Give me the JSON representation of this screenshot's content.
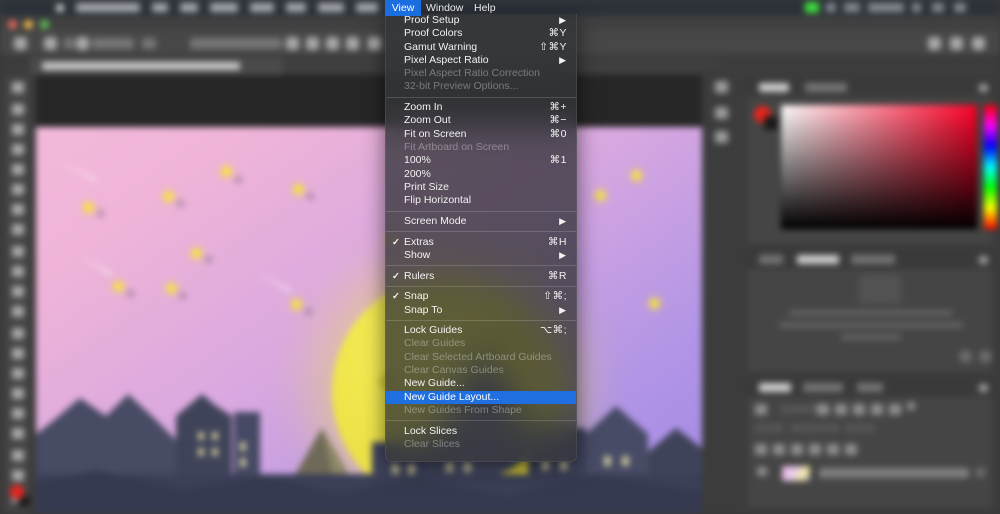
{
  "app": {
    "name": "Photoshop CC",
    "document_tab": "Illustration files with drawing of NIGHT WIELD"
  },
  "menubar": {
    "apple_icon": "apple-icon",
    "items": [
      "Photoshop CC",
      "File",
      "Edit",
      "Image",
      "Layer",
      "Type",
      "Select",
      "Filter",
      "3D"
    ],
    "active_item": "View",
    "after_active": [
      "Window",
      "Help"
    ],
    "status_icons": [
      "battery-icon",
      "bluetooth-icon",
      "wifi-icon",
      "clock-time",
      "search-icon",
      "siri-icon",
      "control-center-icon"
    ],
    "clock": "Tue 08:43"
  },
  "view_menu": {
    "title": "View",
    "groups": [
      {
        "items": [
          {
            "label": "Proof Setup",
            "shortcut": "",
            "submenu": true,
            "checked": false,
            "disabled": false,
            "selected": false
          },
          {
            "label": "Proof Colors",
            "shortcut": "⌘Y",
            "submenu": false,
            "checked": false,
            "disabled": false,
            "selected": false
          },
          {
            "label": "Gamut Warning",
            "shortcut": "⇧⌘Y",
            "submenu": false,
            "checked": false,
            "disabled": false,
            "selected": false
          },
          {
            "label": "Pixel Aspect Ratio",
            "shortcut": "",
            "submenu": true,
            "checked": false,
            "disabled": false,
            "selected": false
          },
          {
            "label": "Pixel Aspect Ratio Correction",
            "shortcut": "",
            "submenu": false,
            "checked": false,
            "disabled": true,
            "selected": false
          },
          {
            "label": "32-bit Preview Options...",
            "shortcut": "",
            "submenu": false,
            "checked": false,
            "disabled": true,
            "selected": false
          }
        ]
      },
      {
        "items": [
          {
            "label": "Zoom In",
            "shortcut": "⌘+",
            "submenu": false,
            "checked": false,
            "disabled": false,
            "selected": false
          },
          {
            "label": "Zoom Out",
            "shortcut": "⌘−",
            "submenu": false,
            "checked": false,
            "disabled": false,
            "selected": false
          },
          {
            "label": "Fit on Screen",
            "shortcut": "⌘0",
            "submenu": false,
            "checked": false,
            "disabled": false,
            "selected": false
          },
          {
            "label": "Fit Artboard on Screen",
            "shortcut": "",
            "submenu": false,
            "checked": false,
            "disabled": true,
            "selected": false
          },
          {
            "label": "100%",
            "shortcut": "⌘1",
            "submenu": false,
            "checked": false,
            "disabled": false,
            "selected": false
          },
          {
            "label": "200%",
            "shortcut": "",
            "submenu": false,
            "checked": false,
            "disabled": false,
            "selected": false
          },
          {
            "label": "Print Size",
            "shortcut": "",
            "submenu": false,
            "checked": false,
            "disabled": false,
            "selected": false
          },
          {
            "label": "Flip Horizontal",
            "shortcut": "",
            "submenu": false,
            "checked": false,
            "disabled": false,
            "selected": false
          }
        ]
      },
      {
        "items": [
          {
            "label": "Screen Mode",
            "shortcut": "",
            "submenu": true,
            "checked": false,
            "disabled": false,
            "selected": false
          }
        ]
      },
      {
        "items": [
          {
            "label": "Extras",
            "shortcut": "⌘H",
            "submenu": false,
            "checked": true,
            "disabled": false,
            "selected": false
          },
          {
            "label": "Show",
            "shortcut": "",
            "submenu": true,
            "checked": false,
            "disabled": false,
            "selected": false
          }
        ]
      },
      {
        "items": [
          {
            "label": "Rulers",
            "shortcut": "⌘R",
            "submenu": false,
            "checked": true,
            "disabled": false,
            "selected": false
          }
        ]
      },
      {
        "items": [
          {
            "label": "Snap",
            "shortcut": "⇧⌘;",
            "submenu": false,
            "checked": true,
            "disabled": false,
            "selected": false
          },
          {
            "label": "Snap To",
            "shortcut": "",
            "submenu": true,
            "checked": false,
            "disabled": false,
            "selected": false
          }
        ]
      },
      {
        "items": [
          {
            "label": "Lock Guides",
            "shortcut": "⌥⌘;",
            "submenu": false,
            "checked": false,
            "disabled": false,
            "selected": false
          },
          {
            "label": "Clear Guides",
            "shortcut": "",
            "submenu": false,
            "checked": false,
            "disabled": true,
            "selected": false
          },
          {
            "label": "Clear Selected Artboard Guides",
            "shortcut": "",
            "submenu": false,
            "checked": false,
            "disabled": true,
            "selected": false
          },
          {
            "label": "Clear Canvas Guides",
            "shortcut": "",
            "submenu": false,
            "checked": false,
            "disabled": true,
            "selected": false
          },
          {
            "label": "New Guide...",
            "shortcut": "",
            "submenu": false,
            "checked": false,
            "disabled": false,
            "selected": false
          },
          {
            "label": "New Guide Layout...",
            "shortcut": "",
            "submenu": false,
            "checked": false,
            "disabled": false,
            "selected": true
          },
          {
            "label": "New Guides From Shape",
            "shortcut": "",
            "submenu": false,
            "checked": false,
            "disabled": true,
            "selected": false
          }
        ]
      },
      {
        "items": [
          {
            "label": "Lock Slices",
            "shortcut": "",
            "submenu": false,
            "checked": false,
            "disabled": false,
            "selected": false
          },
          {
            "label": "Clear Slices",
            "shortcut": "",
            "submenu": false,
            "checked": false,
            "disabled": true,
            "selected": false
          }
        ]
      }
    ]
  },
  "panels": {
    "color_panel": {
      "tabs": [
        "Color",
        "Swatches"
      ],
      "active_tab": "Color",
      "foreground_color": "#e8241d",
      "background_color": "#1a1a1a"
    },
    "properties_panel": {
      "tabs": [
        "Layers",
        "Channels",
        "Paths"
      ],
      "active_tab": "Layers"
    },
    "placeholder_text": "No properties available for the selected layer"
  },
  "artwork": {
    "description": "Night sky illustration with moon, stars and city skyline",
    "sky_top_color": "#f3b9da",
    "sky_bottom_color": "#a389e4",
    "moon_color": "#f0e64a",
    "city_color": "#474b63"
  },
  "colors": {
    "menu_highlight": "#1f6fe0",
    "menubar_active": "#1b6ee0",
    "app_background": "#3c3c3c"
  }
}
